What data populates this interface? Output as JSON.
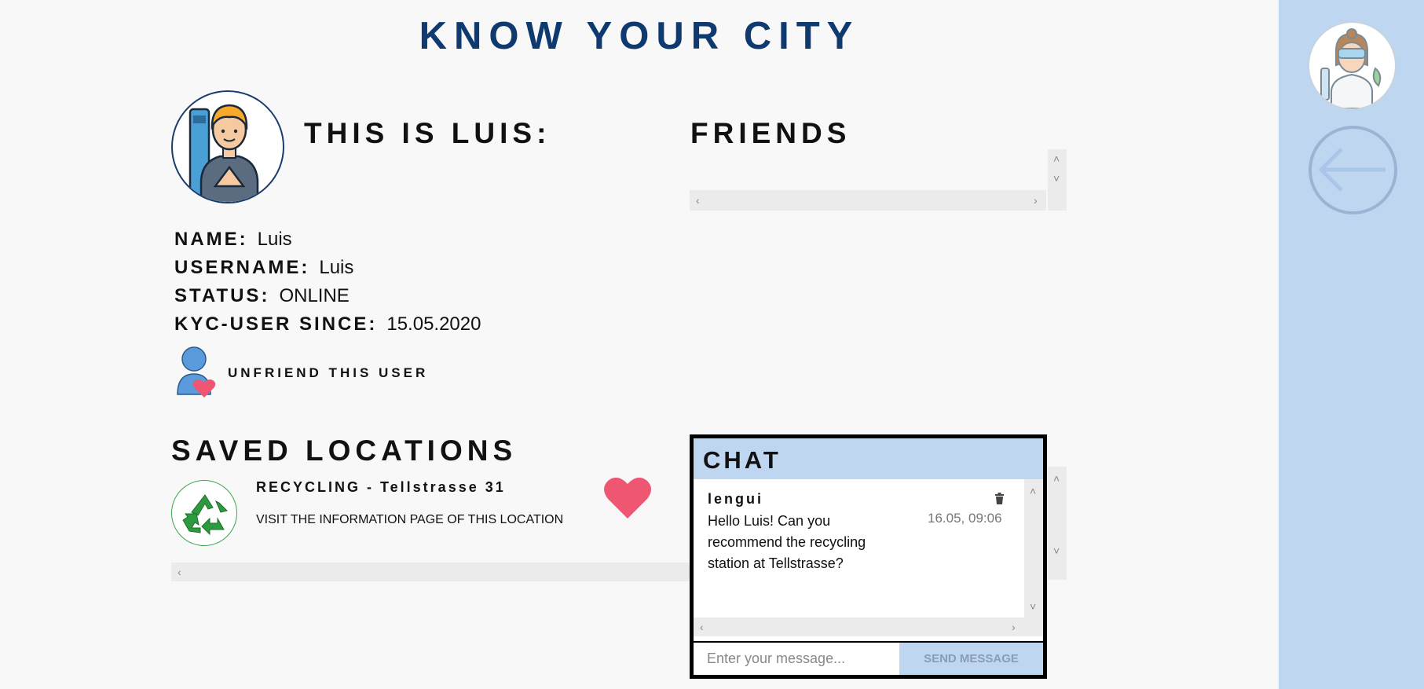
{
  "app": {
    "title": "KNOW YOUR CITY"
  },
  "profile": {
    "heading": "THIS IS LUIS:",
    "fields": [
      {
        "key": "NAME:",
        "value": "Luis"
      },
      {
        "key": "USERNAME:",
        "value": "Luis"
      },
      {
        "key": "STATUS:",
        "value": "ONLINE"
      },
      {
        "key": "KYC-USER SINCE:",
        "value": "15.05.2020"
      }
    ],
    "unfriend_label": "UNFRIEND THIS USER"
  },
  "friends": {
    "heading": "FRIENDS"
  },
  "saved": {
    "heading": "SAVED LOCATIONS",
    "items": [
      {
        "name": "RECYCLING - Tellstrasse 31",
        "link": "VISIT THE INFORMATION PAGE OF THIS LOCATION"
      }
    ]
  },
  "chat": {
    "heading": "CHAT",
    "messages": [
      {
        "user": "lengui",
        "text": "Hello Luis! Can you recommend the recycling station at Tellstrasse?",
        "time": "16.05, 09:06"
      }
    ],
    "input_placeholder": "Enter your message...",
    "send_label": "SEND MESSAGE"
  },
  "colors": {
    "title": "#0f3a70",
    "sidebar": "#bfd6f0",
    "heart": "#ef5672",
    "recycle": "#3aa64a"
  }
}
